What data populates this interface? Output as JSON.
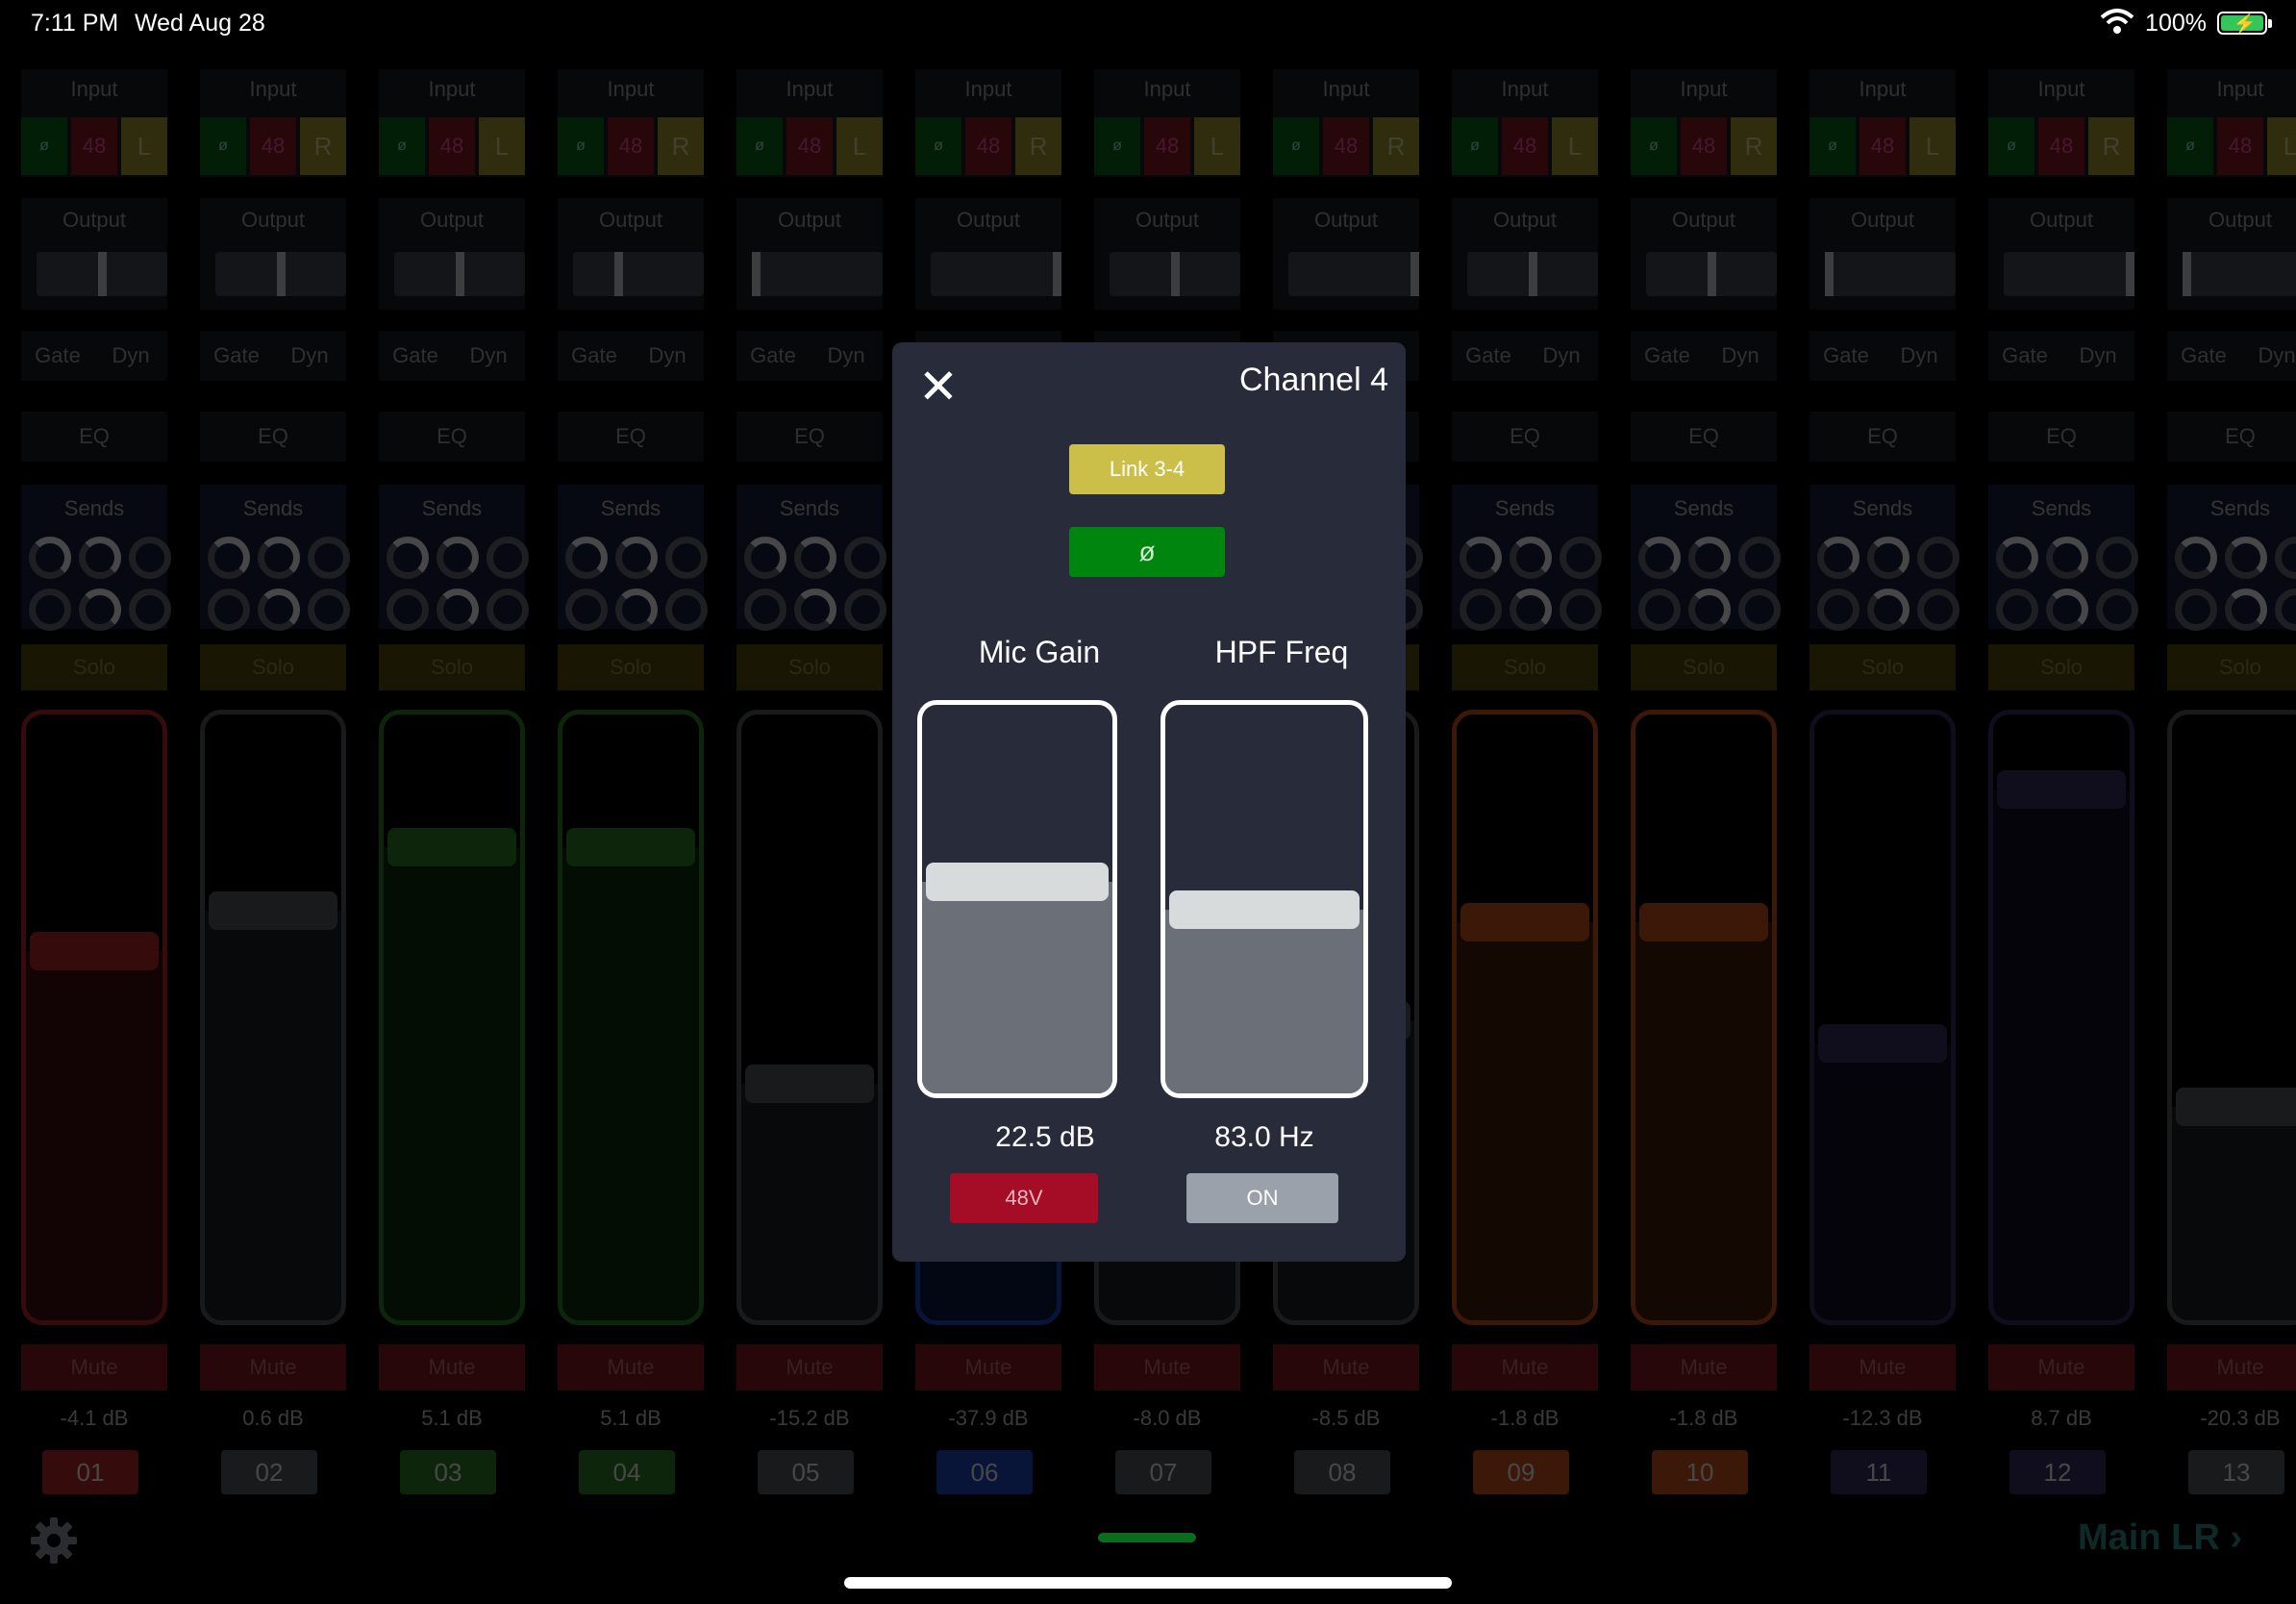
{
  "status_bar": {
    "time": "7:11 PM",
    "date": "Wed Aug 28",
    "battery": "100%",
    "wifi_icon": "wifi-icon",
    "battery_icon": "battery-charging-icon"
  },
  "strip_labels": {
    "input": "Input",
    "output": "Output",
    "gate": "Gate",
    "dyn": "Dyn",
    "eq": "EQ",
    "sends": "Sends",
    "solo": "Solo",
    "mute": "Mute",
    "phase": "ø",
    "p48": "48"
  },
  "channels": [
    {
      "num": "01",
      "level": "-4.1 dB",
      "lr": "L",
      "color": "#c0282c",
      "fader": 0.63,
      "output_pan": 0.5
    },
    {
      "num": "02",
      "level": "0.6 dB",
      "lr": "R",
      "color": "#5a5d66",
      "fader": 0.7,
      "output_pan": 0.5
    },
    {
      "num": "03",
      "level": "5.1 dB",
      "lr": "L",
      "color": "#2f8a2a",
      "fader": 0.81,
      "output_pan": 0.5
    },
    {
      "num": "04",
      "level": "5.1 dB",
      "lr": "R",
      "color": "#2f8a2a",
      "fader": 0.81,
      "output_pan": 0.34
    },
    {
      "num": "05",
      "level": "-15.2 dB",
      "lr": "L",
      "color": "#5a5d66",
      "fader": 0.4,
      "output_pan": 0.0
    },
    {
      "num": "06",
      "level": "-37.9 dB",
      "lr": "R",
      "color": "#1f49c8",
      "fader": 0.18,
      "output_pan": 1.0
    },
    {
      "num": "07",
      "level": "-8.0 dB",
      "lr": "L",
      "color": "#5a5d66",
      "fader": 0.52,
      "output_pan": 0.5
    },
    {
      "num": "08",
      "level": "-8.5 dB",
      "lr": "R",
      "color": "#5a5d66",
      "fader": 0.51,
      "output_pan": 1.0
    },
    {
      "num": "09",
      "level": "-1.8 dB",
      "lr": "L",
      "color": "#d4561c",
      "fader": 0.68,
      "output_pan": 0.5
    },
    {
      "num": "10",
      "level": "-1.8 dB",
      "lr": "R",
      "color": "#d4561c",
      "fader": 0.68,
      "output_pan": 0.5
    },
    {
      "num": "11",
      "level": "-12.3 dB",
      "lr": "L",
      "color": "#3a2f6a",
      "fader": 0.47,
      "output_pan": 0.0
    },
    {
      "num": "12",
      "level": "8.7 dB",
      "lr": "R",
      "color": "#3a2f6a",
      "fader": 0.91,
      "output_pan": 1.0
    },
    {
      "num": "13",
      "level": "-20.3 dB",
      "lr": "L",
      "color": "#5a5d66",
      "fader": 0.36,
      "output_pan": 0.0
    }
  ],
  "footer": {
    "gear_icon": "gear-icon",
    "main_lr": "Main LR ›"
  },
  "modal": {
    "close_icon": "close-icon",
    "close_glyph": "✕",
    "title": "Channel 4",
    "link_label": "Link 3-4",
    "phase_glyph": "ø",
    "mic_gain_label": "Mic Gain",
    "mic_gain_value": "22.5 dB",
    "mic_gain_level": 0.55,
    "hpf_label": "HPF Freq",
    "hpf_value": "83.0 Hz",
    "hpf_level": 0.47,
    "phantom_label": "48V",
    "hpf_on_label": "ON"
  }
}
